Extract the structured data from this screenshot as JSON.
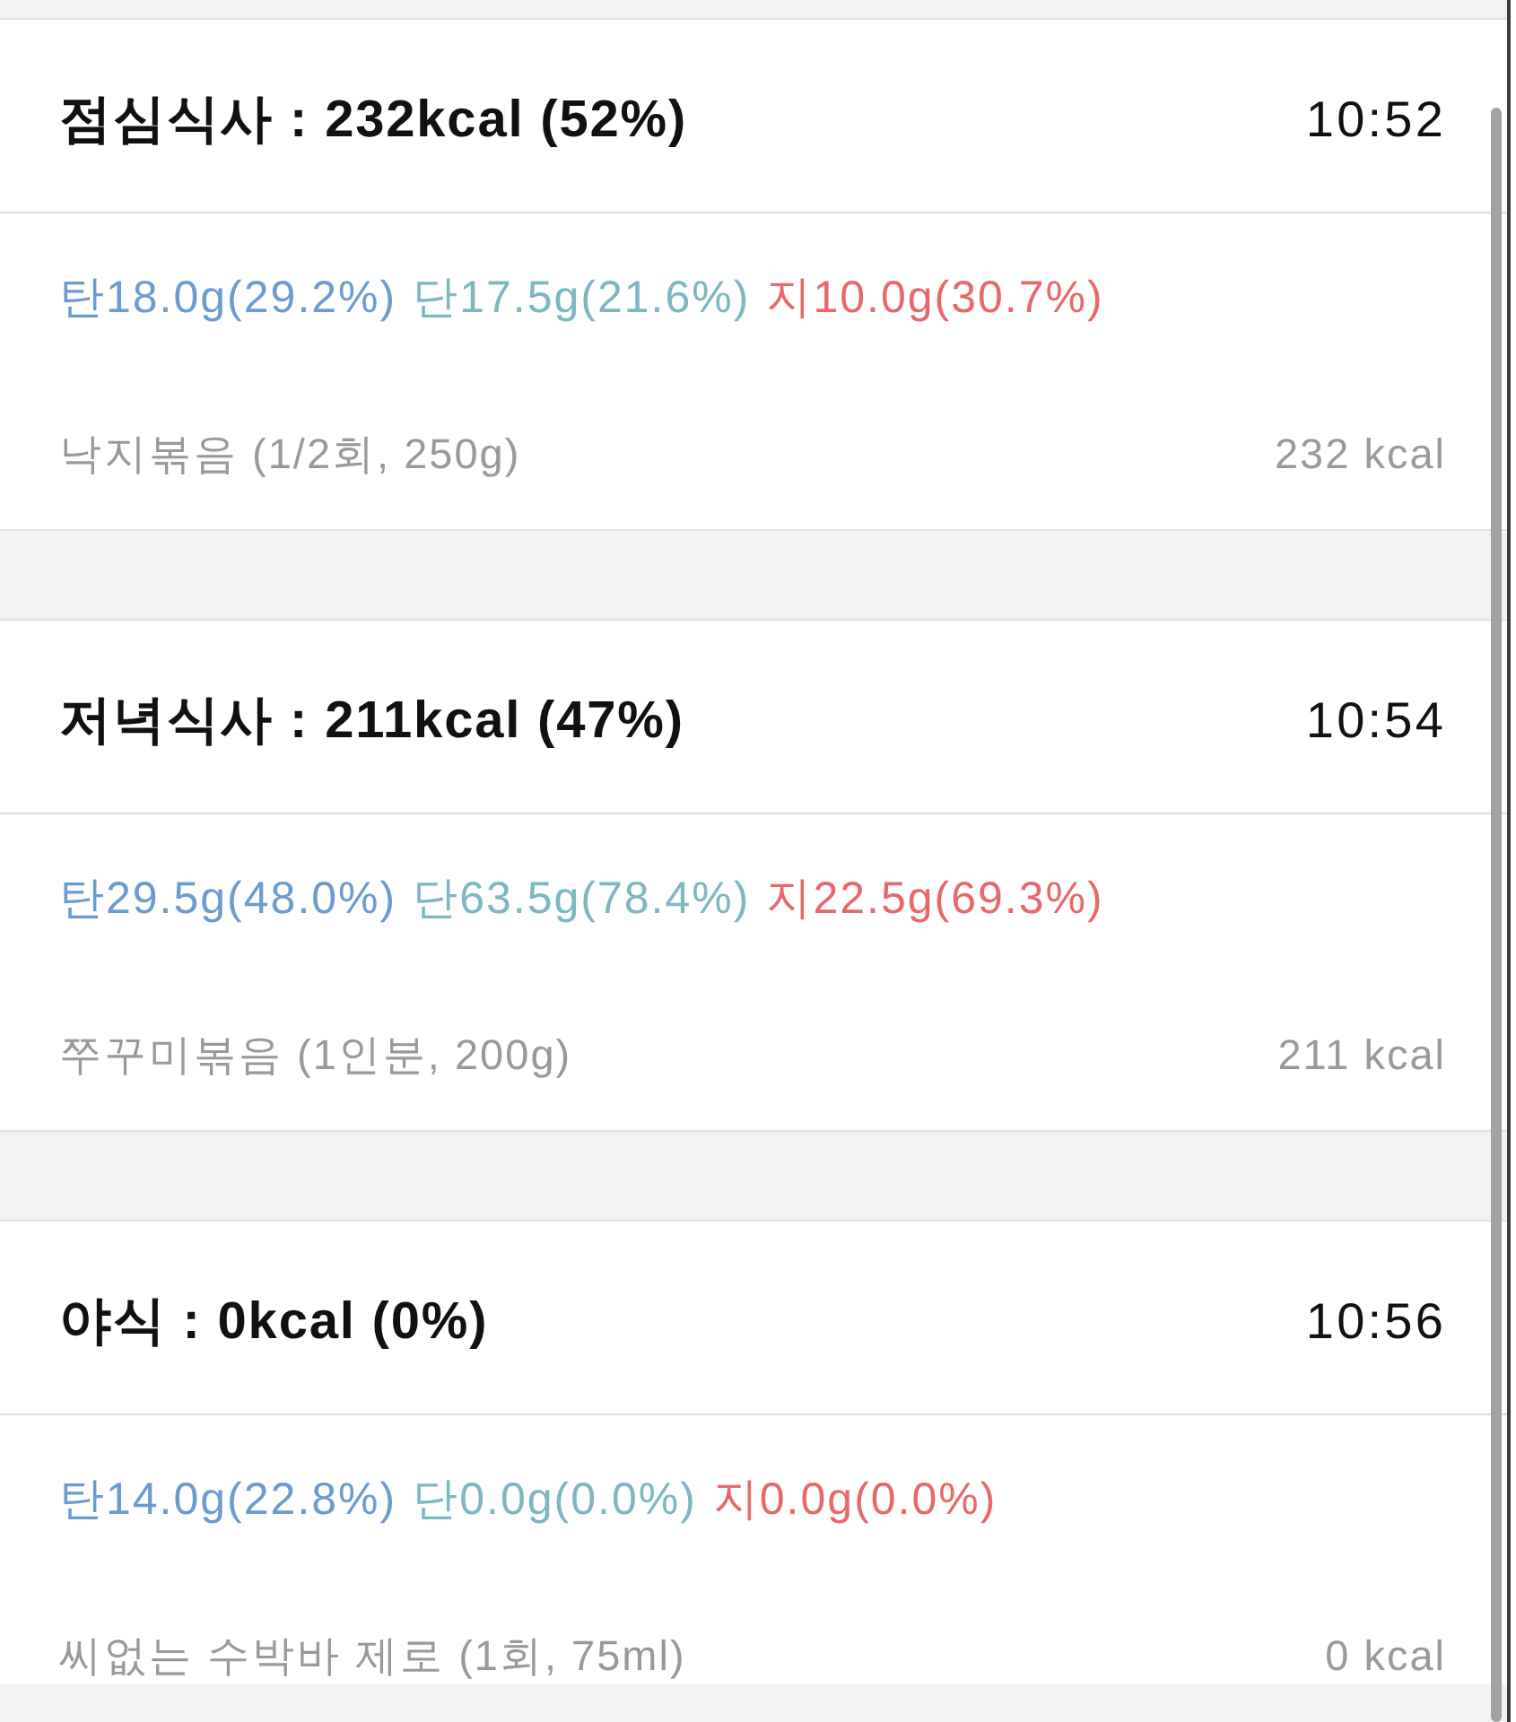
{
  "meals": [
    {
      "title": "점심식사 : 232kcal (52%)",
      "time": "10:52",
      "macros": [
        {
          "text": "탄18.0g(29.2%)",
          "color": "#6b9bcf"
        },
        {
          "text": "단17.5g(21.6%)",
          "color": "#7db7c1"
        },
        {
          "text": "지10.0g(30.7%)",
          "color": "#e8686b"
        }
      ],
      "foods": [
        {
          "name": "낙지볶음 (1/2회, 250g)",
          "calories": "232 kcal"
        }
      ]
    },
    {
      "title": "저녁식사 : 211kcal (47%)",
      "time": "10:54",
      "macros": [
        {
          "text": "탄29.5g(48.0%)",
          "color": "#6b9bcf"
        },
        {
          "text": "단63.5g(78.4%)",
          "color": "#7db7c1"
        },
        {
          "text": "지22.5g(69.3%)",
          "color": "#e8686b"
        }
      ],
      "foods": [
        {
          "name": "쭈꾸미볶음 (1인분, 200g)",
          "calories": "211 kcal"
        }
      ]
    },
    {
      "title": "야식 : 0kcal (0%)",
      "time": "10:56",
      "macros": [
        {
          "text": "탄14.0g(22.8%)",
          "color": "#6b9bcf"
        },
        {
          "text": "단0.0g(0.0%)",
          "color": "#7db7c1"
        },
        {
          "text": "지0.0g(0.0%)",
          "color": "#e8686b"
        }
      ],
      "foods": [
        {
          "name": "씨없는 수박바 제로 (1회, 75ml)",
          "calories": "0 kcal"
        }
      ]
    }
  ]
}
